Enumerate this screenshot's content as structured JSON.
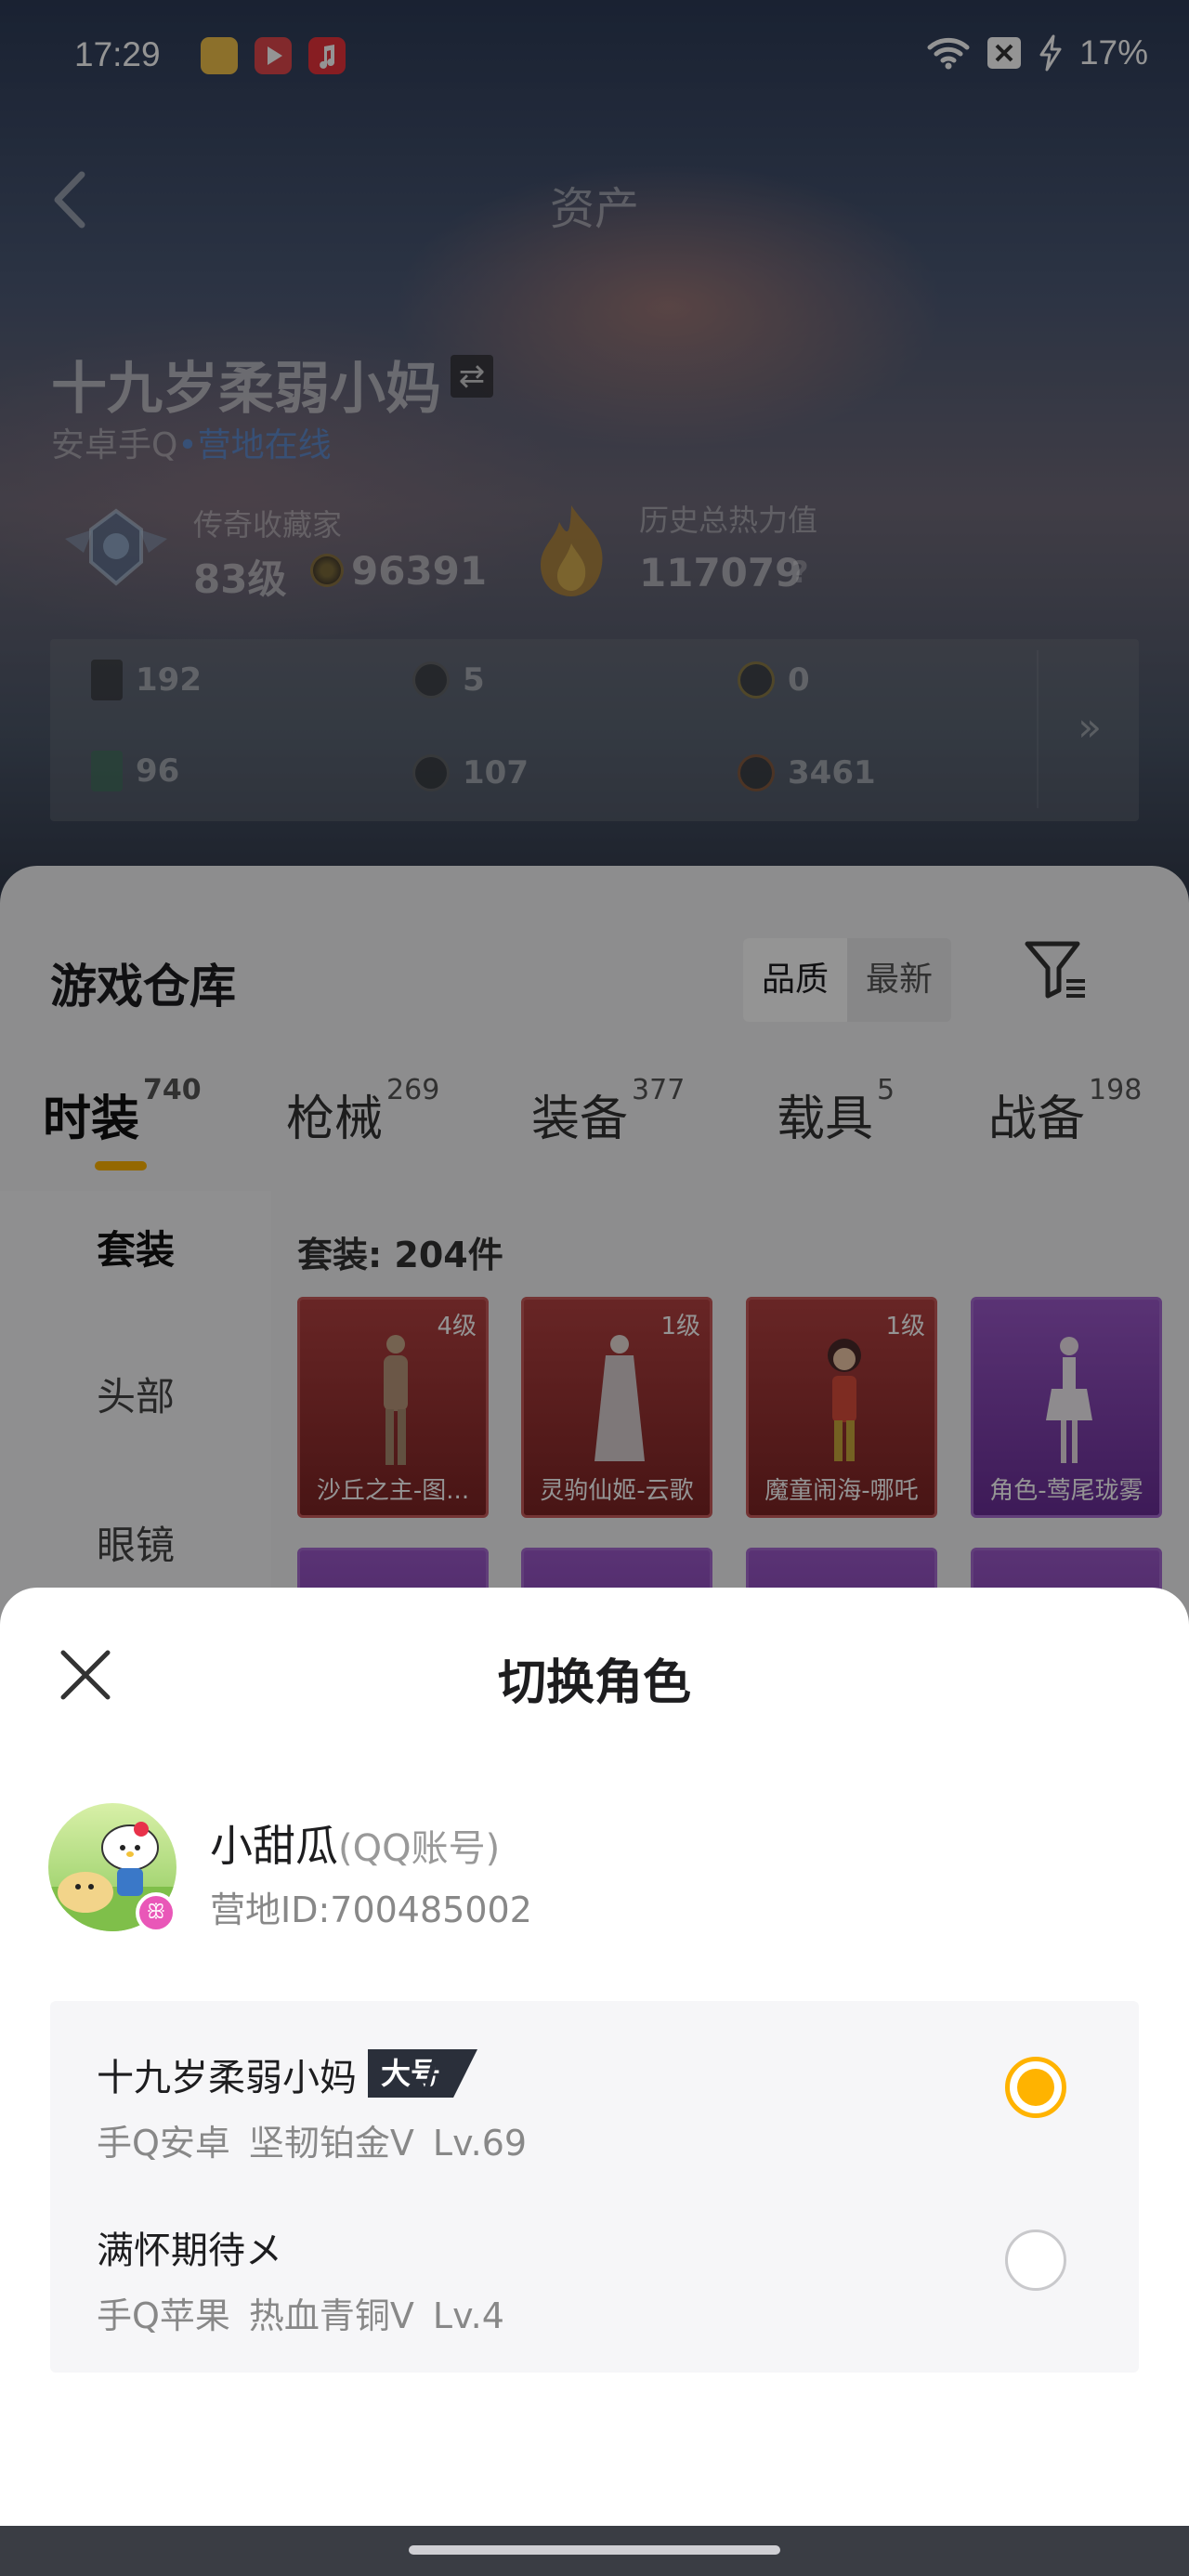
{
  "status_bar": {
    "time": "17:29",
    "battery": "17%",
    "icons": [
      "notes-app-icon",
      "video-app-icon",
      "music-app-icon",
      "wifi-icon",
      "close-box-icon",
      "charging-bolt-icon"
    ]
  },
  "header": {
    "title": "资产",
    "back_icon": "chevron-left-icon"
  },
  "profile": {
    "name": "十九岁柔弱小妈",
    "swap_glyph": "⇄",
    "platform": "安卓手Q",
    "status": "营地在线",
    "rank_title": "传奇收藏家",
    "rank_level": "83级",
    "coins": "96391",
    "heat_title": "历史总热力值",
    "heat_value": "117079",
    "help": "?"
  },
  "assets": [
    {
      "value": "192",
      "icon": "card-icon"
    },
    {
      "value": "5",
      "icon": "coin-icon"
    },
    {
      "value": "0",
      "icon": "gold-coin-icon"
    },
    {
      "value": "96",
      "icon": "green-card-icon"
    },
    {
      "value": "107",
      "icon": "coin-icon"
    },
    {
      "value": "3461",
      "icon": "bronze-coin-icon"
    }
  ],
  "assets_more": "»",
  "warehouse": {
    "title": "游戏仓库",
    "sort_options": [
      "品质",
      "最新"
    ],
    "tabs": [
      {
        "label": "时装",
        "count": "740"
      },
      {
        "label": "枪械",
        "count": "269"
      },
      {
        "label": "装备",
        "count": "377"
      },
      {
        "label": "载具",
        "count": "5"
      },
      {
        "label": "战备",
        "count": "198"
      }
    ],
    "side_categories": [
      "套装",
      "头部",
      "眼镜"
    ],
    "suits_count": "套装: 204件",
    "items": [
      {
        "level": "4级",
        "name": "沙丘之主-图...",
        "rarity": "red"
      },
      {
        "level": "1级",
        "name": "灵驹仙姬-云歌",
        "rarity": "red"
      },
      {
        "level": "1级",
        "name": "魔童闹海-哪吒",
        "rarity": "red"
      },
      {
        "level": "",
        "name": "角色-莺尾珑雾",
        "rarity": "purple"
      }
    ]
  },
  "modal": {
    "title": "切换角色",
    "account": {
      "name": "小甜瓜",
      "type": "(QQ账号)",
      "camp_id": "营地ID:700485002"
    },
    "roles": [
      {
        "name": "十九岁柔弱小妈",
        "badge": "大号",
        "platform": "手Q安卓",
        "tier": "坚韧铂金V",
        "level": "Lv.69",
        "selected": true
      },
      {
        "name": "满怀期待メ",
        "badge": "",
        "platform": "手Q苹果",
        "tier": "热血青铜V",
        "level": "Lv.4",
        "selected": false
      }
    ]
  },
  "colors": {
    "accent": "#ffb300",
    "red_rarity": "#b34141",
    "purple_rarity": "#9b58c9",
    "online": "#4a8fe0"
  }
}
